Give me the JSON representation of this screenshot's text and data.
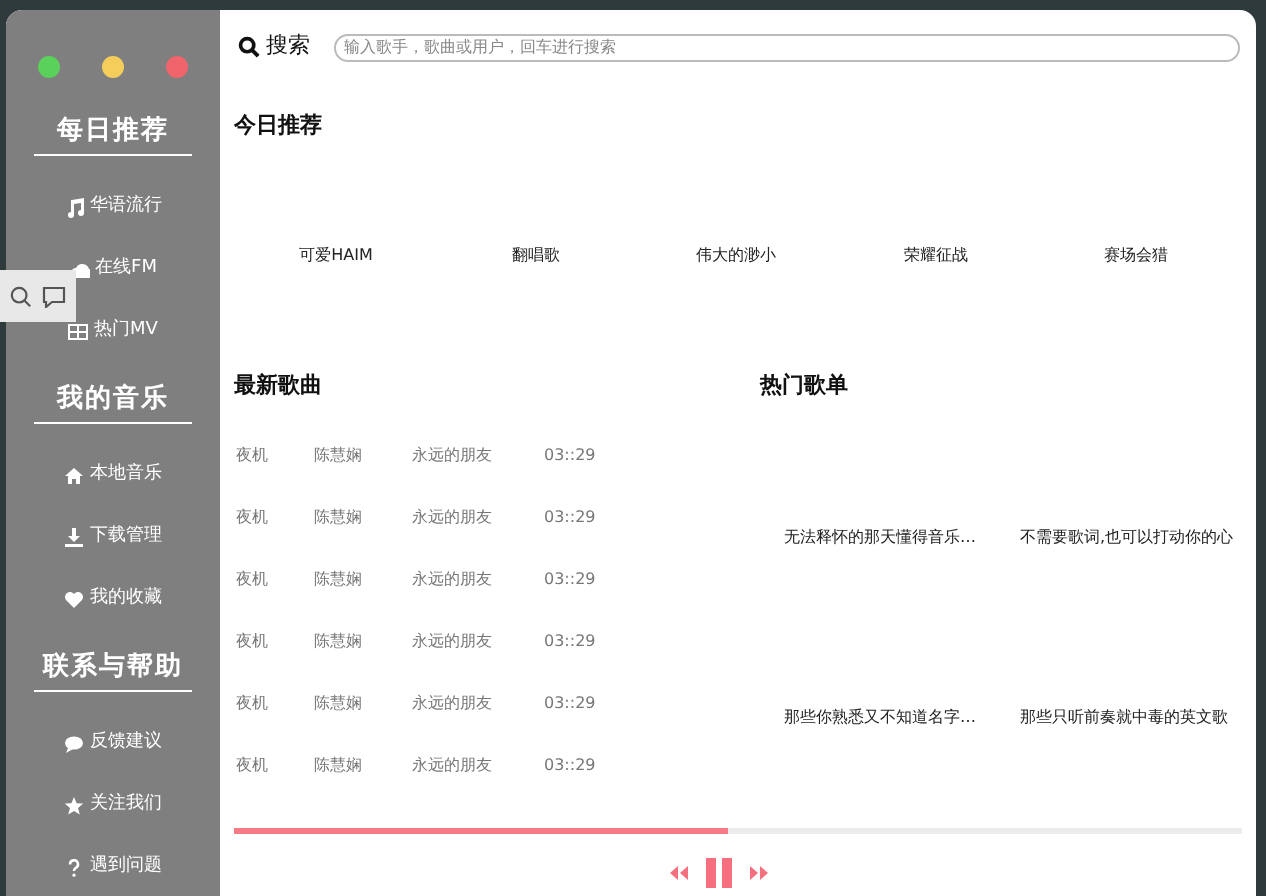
{
  "search": {
    "label": "搜索",
    "placeholder": "输入歌手，歌曲或用户，回车进行搜索"
  },
  "sidebar": {
    "sections": [
      {
        "heading": "每日推荐",
        "items": [
          {
            "label": "华语流行",
            "kind": "music"
          },
          {
            "label": "在线FM",
            "kind": "cloud"
          },
          {
            "label": "热门MV",
            "kind": "film"
          }
        ]
      },
      {
        "heading": "我的音乐",
        "items": [
          {
            "label": "本地音乐",
            "kind": "home"
          },
          {
            "label": "下载管理",
            "kind": "download"
          },
          {
            "label": "我的收藏",
            "kind": "heart"
          }
        ]
      },
      {
        "heading": "联系与帮助",
        "items": [
          {
            "label": "反馈建议",
            "kind": "chat"
          },
          {
            "label": "关注我们",
            "kind": "star"
          },
          {
            "label": "遇到问题",
            "kind": "question"
          }
        ]
      }
    ]
  },
  "today": {
    "title": "今日推荐",
    "items": [
      "可爱HAIM",
      "翻唱歌",
      "伟大的渺小",
      "荣耀征战",
      "赛场会猎"
    ]
  },
  "new_songs": {
    "title": "最新歌曲",
    "rows": [
      [
        "夜机",
        "陈慧娴",
        "永远的朋友",
        "03::29"
      ],
      [
        "夜机",
        "陈慧娴",
        "永远的朋友",
        "03::29"
      ],
      [
        "夜机",
        "陈慧娴",
        "永远的朋友",
        "03::29"
      ],
      [
        "夜机",
        "陈慧娴",
        "永远的朋友",
        "03::29"
      ],
      [
        "夜机",
        "陈慧娴",
        "永远的朋友",
        "03::29"
      ],
      [
        "夜机",
        "陈慧娴",
        "永远的朋友",
        "03::29"
      ]
    ]
  },
  "hot_playlists": {
    "title": "热门歌单",
    "items": [
      "无法释怀的那天懂得音乐…",
      "不需要歌词,也可以打动你的心",
      "那些你熟悉又不知道名字…",
      "那些只听前奏就中毒的英文歌"
    ]
  },
  "player": {
    "level": 0.49,
    "playing": true
  }
}
